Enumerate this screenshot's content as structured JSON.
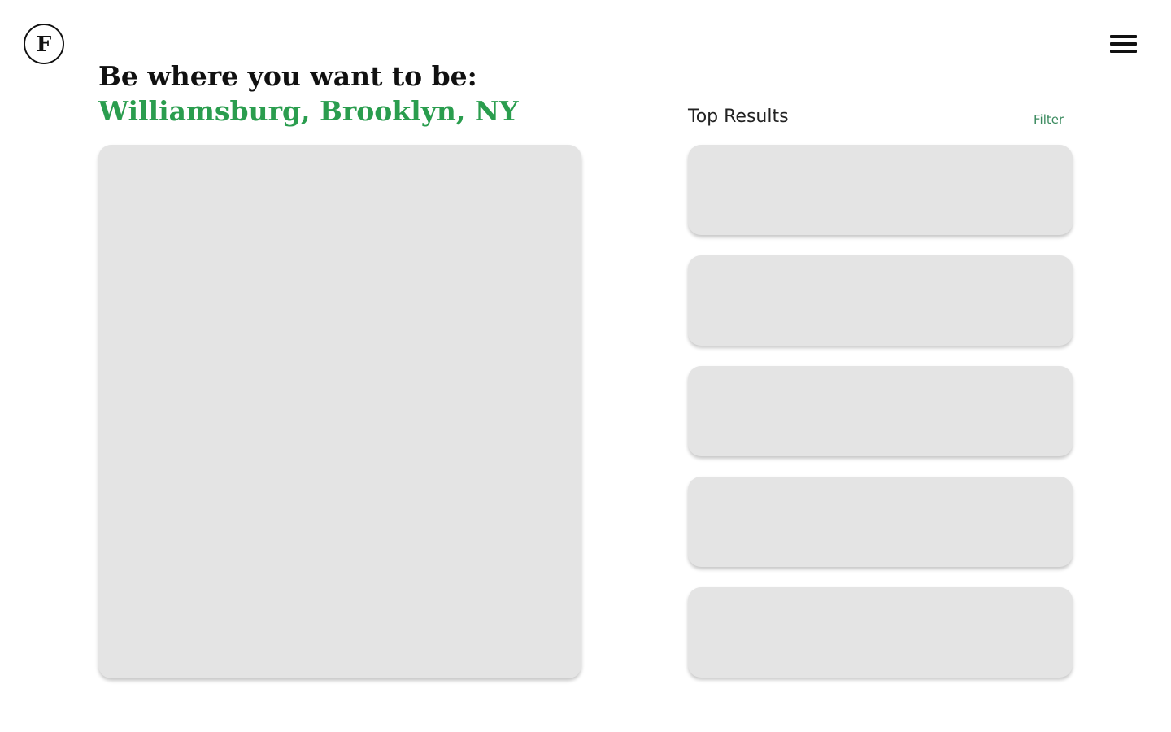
{
  "logo": {
    "letter": "F"
  },
  "menu": {
    "icon": "hamburger-menu-icon"
  },
  "hero": {
    "headline": "Be where you want to be:",
    "location": "Williamsburg, Brooklyn, NY"
  },
  "results": {
    "title": "Top Results",
    "filter_label": "Filter",
    "card_count": 5
  },
  "colors": {
    "accent": "#2a9d4e",
    "filter_link": "#3a8a5e",
    "text": "#111111",
    "placeholder": "#e4e4e4",
    "background": "#ffffff"
  }
}
